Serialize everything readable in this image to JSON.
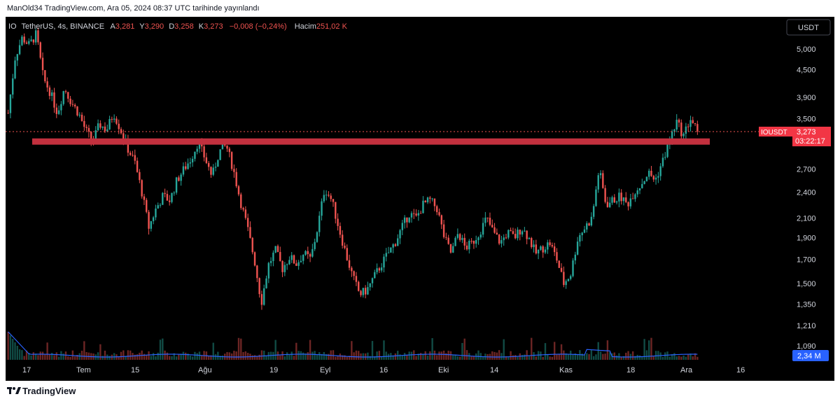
{
  "header": {
    "text": "ManOld34 TradingView.com, Ara 05, 2024 08:37 UTC tarihinde yayınlandı"
  },
  "footer": {
    "brand": "TradingView"
  },
  "legend": {
    "symbol": "IO",
    "pair": "TetherUS, 4s, BINANCE",
    "open_label": "A",
    "open": "3,281",
    "high_label": "Y",
    "high": "3,290",
    "low_label": "D",
    "low": "3,258",
    "close_label": "K",
    "close": "3,273",
    "change": "−0,008 (−0,24%)",
    "volume_label": "Hacim",
    "volume": "251,02 K"
  },
  "currency_button": "USDT",
  "price_label": {
    "symbol": "IOUSDT",
    "price": "3,273",
    "countdown": "03:22:17"
  },
  "volume_label": "2,34 M",
  "colors": {
    "up": "#26a69a",
    "down": "#ef5350",
    "band": "#c2303e",
    "price_tag": "#f23645",
    "volume_line": "#2962ff"
  },
  "chart_data": {
    "type": "candlestick",
    "symbol": "IOUSDT",
    "timeframe": "4s",
    "exchange": "BINANCE",
    "yaxis_ticks": [
      5.0,
      4.5,
      3.9,
      3.5,
      2.7,
      2.4,
      2.1,
      1.9,
      1.7,
      1.5,
      1.35,
      1.21,
      1.09
    ],
    "yaxis_tick_labels": [
      "5,000",
      "4,500",
      "3,900",
      "3,500",
      "2,700",
      "2,400",
      "2,100",
      "1,900",
      "1,700",
      "1,500",
      "1,350",
      "1,210",
      "1,090"
    ],
    "xaxis_tick_labels": [
      "17",
      "Tem",
      "15",
      "Ağu",
      "19",
      "Eyl",
      "16",
      "Eki",
      "14",
      "Kas",
      "18",
      "Ara",
      "16"
    ],
    "yscale": "log",
    "last_price": 3.273,
    "resistance_band": [
      3.06,
      3.16
    ],
    "price_path": [
      [
        0,
        3.6
      ],
      [
        1,
        4.8
      ],
      [
        2,
        5.3
      ],
      [
        3,
        5.1
      ],
      [
        4,
        5.4
      ],
      [
        5,
        4.3
      ],
      [
        6,
        4.0
      ],
      [
        7,
        3.6
      ],
      [
        8,
        4.1
      ],
      [
        9,
        3.8
      ],
      [
        10,
        3.6
      ],
      [
        11,
        3.3
      ],
      [
        12,
        3.1
      ],
      [
        13,
        3.4
      ],
      [
        14,
        3.3
      ],
      [
        15,
        3.6
      ],
      [
        16,
        3.3
      ],
      [
        17,
        3.0
      ],
      [
        18,
        2.8
      ],
      [
        19,
        2.4
      ],
      [
        20,
        2.0
      ],
      [
        21,
        2.2
      ],
      [
        22,
        2.35
      ],
      [
        23,
        2.3
      ],
      [
        24,
        2.55
      ],
      [
        25,
        2.7
      ],
      [
        26,
        2.85
      ],
      [
        27,
        3.1
      ],
      [
        28,
        2.85
      ],
      [
        29,
        2.6
      ],
      [
        30,
        2.95
      ],
      [
        31,
        3.05
      ],
      [
        32,
        2.7
      ],
      [
        33,
        2.3
      ],
      [
        34,
        2.0
      ],
      [
        35,
        1.7
      ],
      [
        36,
        1.36
      ],
      [
        37,
        1.65
      ],
      [
        38,
        1.78
      ],
      [
        39,
        1.62
      ],
      [
        40,
        1.72
      ],
      [
        41,
        1.66
      ],
      [
        42,
        1.75
      ],
      [
        43,
        1.7
      ],
      [
        44,
        2.0
      ],
      [
        45,
        2.45
      ],
      [
        46,
        2.3
      ],
      [
        47,
        2.0
      ],
      [
        48,
        1.75
      ],
      [
        49,
        1.55
      ],
      [
        50,
        1.42
      ],
      [
        51,
        1.45
      ],
      [
        52,
        1.55
      ],
      [
        53,
        1.65
      ],
      [
        54,
        1.75
      ],
      [
        55,
        1.85
      ],
      [
        56,
        2.0
      ],
      [
        57,
        2.15
      ],
      [
        58,
        2.1
      ],
      [
        59,
        2.25
      ],
      [
        60,
        2.3
      ],
      [
        61,
        2.2
      ],
      [
        62,
        1.9
      ],
      [
        63,
        1.75
      ],
      [
        64,
        1.95
      ],
      [
        65,
        1.8
      ],
      [
        66,
        1.85
      ],
      [
        67,
        1.95
      ],
      [
        68,
        2.1
      ],
      [
        69,
        1.95
      ],
      [
        70,
        1.85
      ],
      [
        71,
        1.95
      ],
      [
        72,
        1.9
      ],
      [
        73,
        2.0
      ],
      [
        74,
        1.9
      ],
      [
        75,
        1.75
      ],
      [
        76,
        1.8
      ],
      [
        77,
        1.85
      ],
      [
        78,
        1.7
      ],
      [
        79,
        1.5
      ],
      [
        80,
        1.58
      ],
      [
        81,
        1.9
      ],
      [
        82,
        2.0
      ],
      [
        83,
        2.1
      ],
      [
        84,
        2.7
      ],
      [
        85,
        2.25
      ],
      [
        86,
        2.3
      ],
      [
        87,
        2.35
      ],
      [
        88,
        2.25
      ],
      [
        89,
        2.4
      ],
      [
        90,
        2.5
      ],
      [
        91,
        2.65
      ],
      [
        92,
        2.55
      ],
      [
        93,
        2.8
      ],
      [
        94,
        3.1
      ],
      [
        95,
        3.45
      ],
      [
        96,
        3.2
      ],
      [
        97,
        3.5
      ],
      [
        98,
        3.273
      ]
    ]
  }
}
